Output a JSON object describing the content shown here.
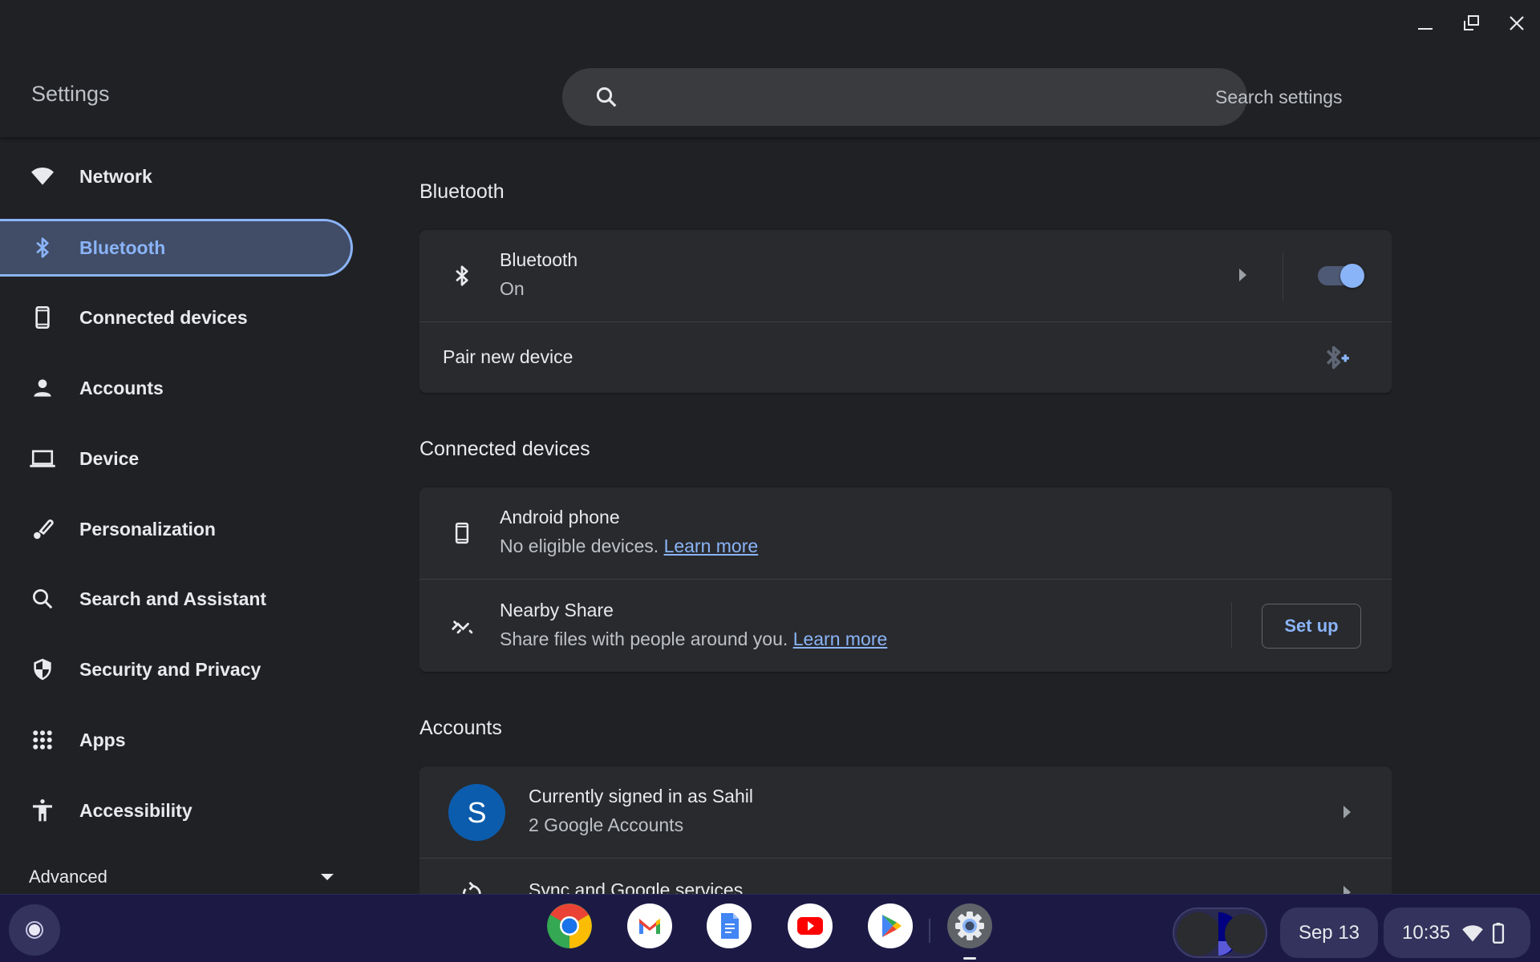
{
  "window": {
    "title": "Settings",
    "controls": {
      "minimize": "minimize-icon",
      "restore": "restore-icon",
      "close": "close-icon"
    }
  },
  "search": {
    "placeholder": "Search settings",
    "value": "",
    "icon": "search-icon"
  },
  "sidebar": {
    "selected": "Bluetooth",
    "items": [
      {
        "label": "Network",
        "icon": "wifi-icon"
      },
      {
        "label": "Bluetooth",
        "icon": "bluetooth-icon"
      },
      {
        "label": "Connected devices",
        "icon": "phone-icon"
      },
      {
        "label": "Accounts",
        "icon": "person-icon"
      },
      {
        "label": "Device",
        "icon": "laptop-icon"
      },
      {
        "label": "Personalization",
        "icon": "brush-icon"
      },
      {
        "label": "Search and Assistant",
        "icon": "search-icon"
      },
      {
        "label": "Security and Privacy",
        "icon": "shield-icon"
      },
      {
        "label": "Apps",
        "icon": "apps-grid-icon"
      },
      {
        "label": "Accessibility",
        "icon": "accessibility-icon"
      }
    ],
    "advanced": {
      "label": "Advanced",
      "icon": "caret-down-icon"
    }
  },
  "sections": {
    "bluetooth": {
      "title": "Bluetooth",
      "main_row": {
        "title": "Bluetooth",
        "status": "On",
        "toggle_on": true
      },
      "pair_row": {
        "title": "Pair new device",
        "icon": "bluetooth-add-icon"
      }
    },
    "connected_devices": {
      "title": "Connected devices",
      "android": {
        "title": "Android phone",
        "subtitle": "No eligible devices.",
        "link": "Learn more"
      },
      "nearby": {
        "title": "Nearby Share",
        "subtitle": "Share files with people around you.",
        "link": "Learn more",
        "button": "Set up"
      }
    },
    "accounts": {
      "title": "Accounts",
      "signed_in": {
        "avatar_letter": "S",
        "title": "Currently signed in as Sahil",
        "subtitle": "2 Google Accounts"
      },
      "sync": {
        "title": "Sync and Google services"
      }
    }
  },
  "shelf": {
    "apps": [
      {
        "name": "Chrome"
      },
      {
        "name": "Gmail"
      },
      {
        "name": "Docs"
      },
      {
        "name": "YouTube"
      },
      {
        "name": "Play Store"
      },
      {
        "name": "Settings",
        "running": true
      }
    ],
    "date": "Sep 13",
    "time": "10:35"
  },
  "colors": {
    "accent": "#8ab4f8",
    "background": "#202124",
    "card": "#292a2d",
    "selected_nav": "#414c66",
    "shelf": "#1c1a45",
    "avatar": "#0b5cad"
  }
}
